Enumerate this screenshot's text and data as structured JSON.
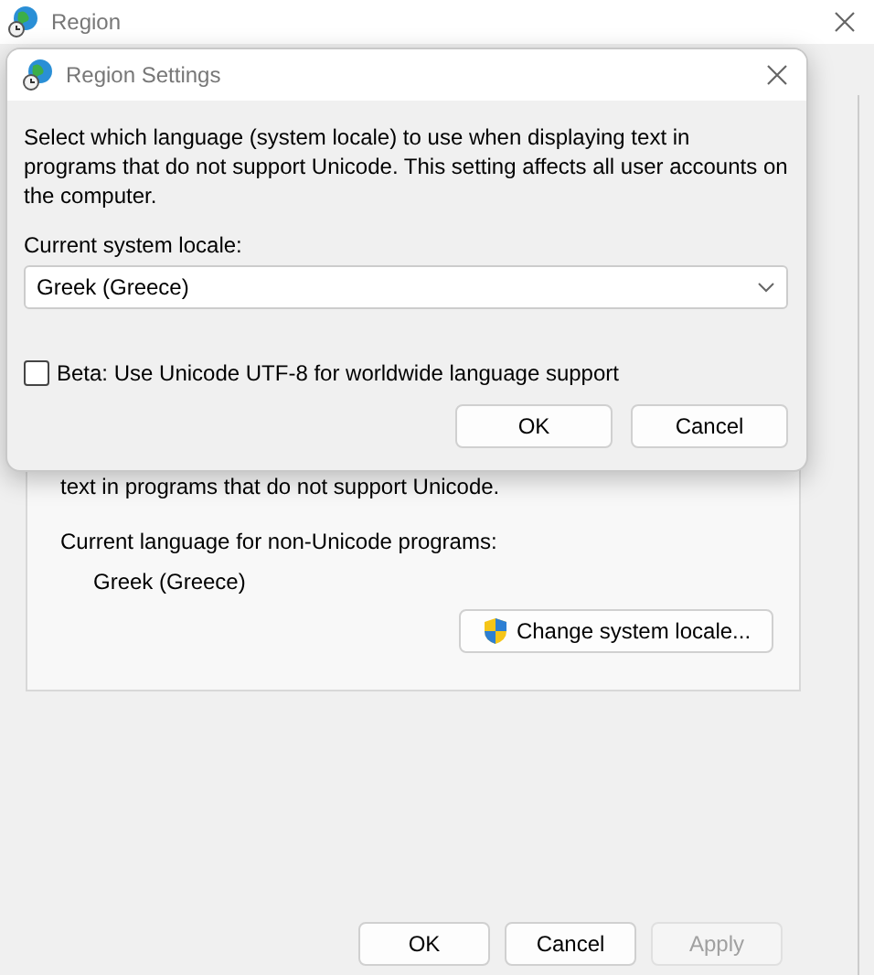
{
  "window": {
    "title": "Region"
  },
  "panel": {
    "hidden_text": "text in programs that do not support Unicode.",
    "current_label": "Current language for non-Unicode programs:",
    "current_value": "Greek (Greece)",
    "change_button": "Change system locale..."
  },
  "buttons": [
    {
      "label": "OK",
      "disabled": false
    },
    {
      "label": "Cancel",
      "disabled": false
    },
    {
      "label": "Apply",
      "disabled": true
    }
  ],
  "dialog": {
    "title": "Region Settings",
    "description": "Select which language (system locale) to use when displaying text in programs that do not support Unicode. This setting affects all user accounts on the computer.",
    "locale_label": "Current system locale:",
    "locale_value": "Greek (Greece)",
    "beta": {
      "label": "Beta: Use Unicode UTF-8 for worldwide language support",
      "checked": false
    },
    "buttons": [
      {
        "label": "OK"
      },
      {
        "label": "Cancel"
      }
    ]
  }
}
